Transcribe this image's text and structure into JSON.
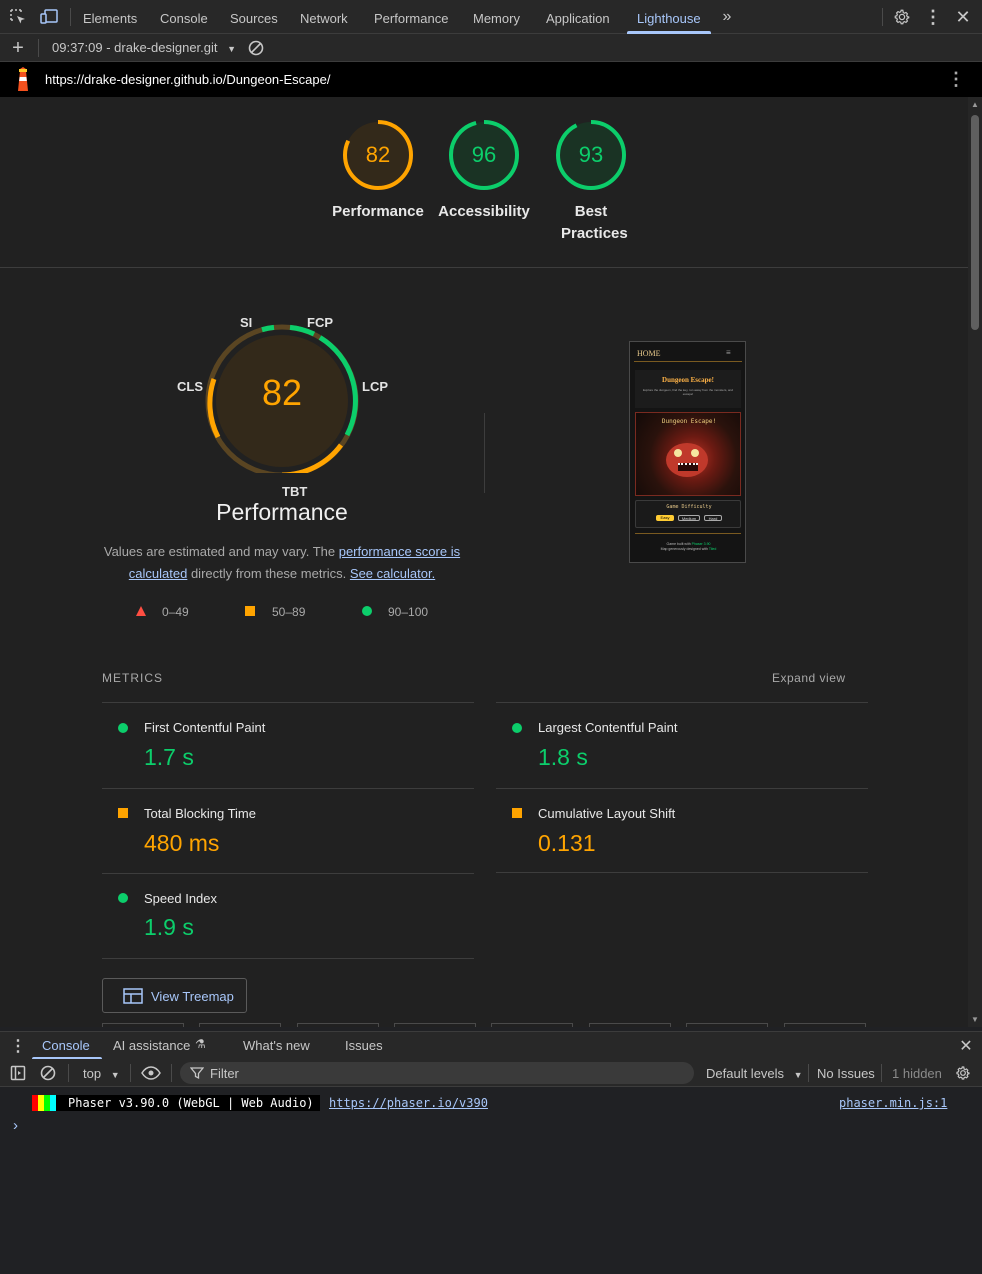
{
  "devtools": {
    "tabs": [
      "Elements",
      "Console",
      "Sources",
      "Network",
      "Performance",
      "Memory",
      "Application",
      "Lighthouse"
    ],
    "active_tab": "Lighthouse",
    "more_tabs_icon": "chevron-double-right-icon"
  },
  "report_toolbar": {
    "report_selector": "09:37:09 - drake-designer.git"
  },
  "url_bar": {
    "url": "https://drake-designer.github.io/Dungeon-Escape/"
  },
  "summary_gauges": [
    {
      "label": "Performance",
      "score": "82",
      "color": "#ffa400"
    },
    {
      "label": "Accessibility",
      "score": "96",
      "color": "#0cce6b"
    },
    {
      "label": "Best Practices",
      "score": "93",
      "color": "#0cce6b"
    }
  ],
  "performance_section": {
    "score": "82",
    "title": "Performance",
    "gauge_metric_labels": {
      "si": "SI",
      "fcp": "FCP",
      "lcp": "LCP",
      "tbt": "TBT",
      "cls": "CLS"
    },
    "note_prefix": "Values are estimated and may vary. The ",
    "note_link1": "performance score is calculated",
    "note_middle": " directly from these metrics.",
    "note_link2": "See calculator.",
    "legend": [
      {
        "range": "0–49",
        "shape": "triangle",
        "color": "#ff4e42"
      },
      {
        "range": "50–89",
        "shape": "square",
        "color": "#ffa400"
      },
      {
        "range": "90–100",
        "shape": "circle",
        "color": "#0cce6b"
      }
    ]
  },
  "screenshot_preview": {
    "nav_home": "HOME",
    "title": "Dungeon Escape!",
    "subtitle": "Explore the dungeon, find the key, run away from the monsters, and escape!",
    "banner": "Dungeon Escape!",
    "difficulty_title": "Game Difficulty",
    "difficulty_options": [
      "Easy",
      "Medium",
      "Hard"
    ],
    "footer_line1_prefix": "Game built with ",
    "footer_line1_link": "Phaser 3.90",
    "footer_line2_prefix": "Map generously designed with ",
    "footer_line2_link": "Tiled"
  },
  "metrics": {
    "heading": "METRICS",
    "expand_label": "Expand view",
    "items": [
      {
        "name": "First Contentful Paint",
        "value": "1.7 s",
        "status": "green"
      },
      {
        "name": "Largest Contentful Paint",
        "value": "1.8 s",
        "status": "green"
      },
      {
        "name": "Total Blocking Time",
        "value": "480 ms",
        "status": "orange"
      },
      {
        "name": "Cumulative Layout Shift",
        "value": "0.131",
        "status": "orange"
      },
      {
        "name": "Speed Index",
        "value": "1.9 s",
        "status": "green"
      }
    ],
    "treemap_button": "View Treemap"
  },
  "drawer": {
    "tabs": [
      "Console",
      "AI assistance",
      "What's new",
      "Issues"
    ],
    "active_tab": "Console",
    "context": "top",
    "filter_placeholder": "Filter",
    "levels": "Default levels",
    "issues": "No Issues",
    "hidden": "1 hidden"
  },
  "console": {
    "messages": [
      {
        "text": "Phaser v3.90.0 (WebGL | Web Audio)",
        "link": "https://phaser.io/v390",
        "source": "phaser.min.js:1"
      }
    ],
    "prompt": "›"
  },
  "colors": {
    "pass": "#0cce6b",
    "average": "#ffa400",
    "fail": "#ff4e42",
    "accent": "#a8c7fa"
  }
}
